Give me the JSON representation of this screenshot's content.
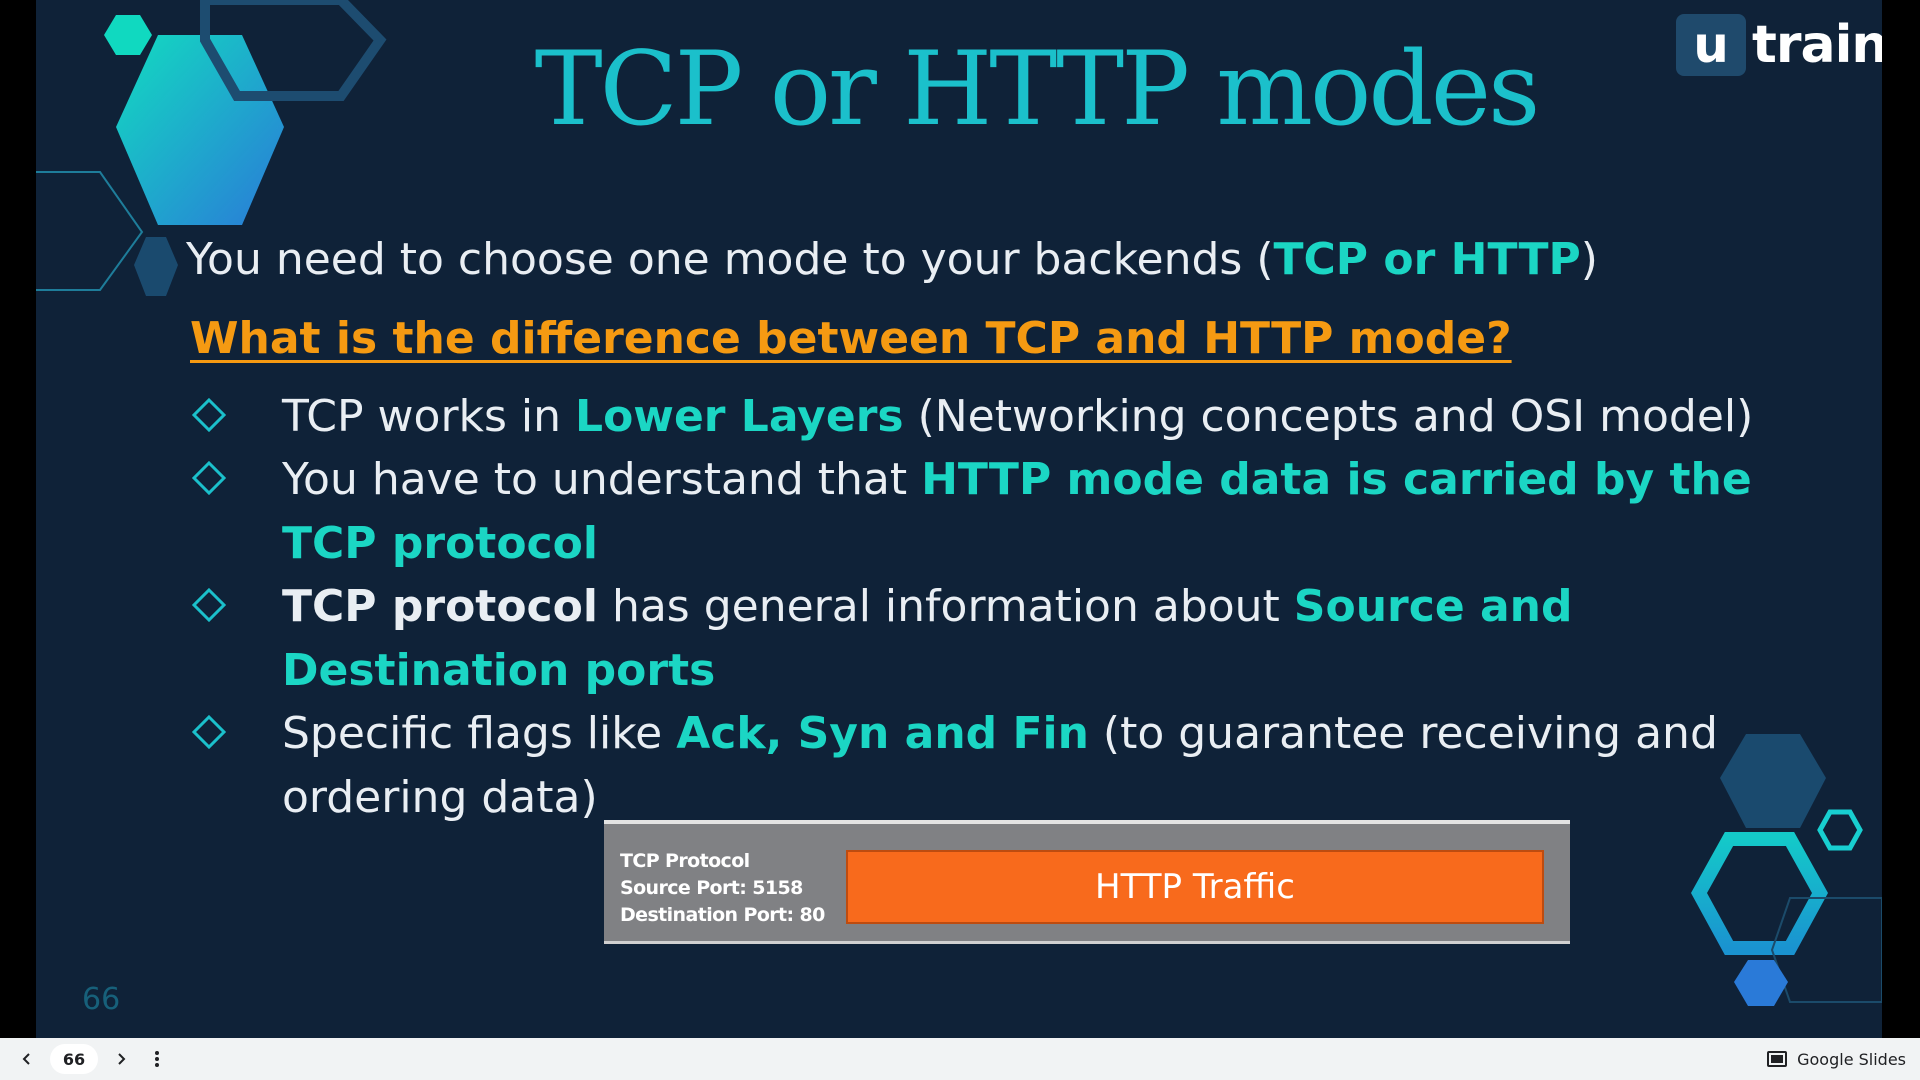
{
  "slide": {
    "title": "TCP or HTTP modes",
    "logo": {
      "mark": "u",
      "word": "train"
    },
    "intro": {
      "before": "You need to choose one mode to your backends (",
      "highlight": "TCP or HTTP",
      "after": ")"
    },
    "question": "What is the difference between TCP and HTTP mode?",
    "bullets": [
      {
        "icon": "diamond-bullet-icon",
        "lines": [
          {
            "a": "TCP works in ",
            "b": "Lower Layers",
            "c": " (Networking concepts and OSI model)"
          }
        ]
      },
      {
        "icon": "diamond-bullet-icon",
        "lines": [
          {
            "a": "You have to understand that ",
            "b": "HTTP mode data is carried by the"
          },
          {
            "b": "TCP protocol"
          }
        ]
      },
      {
        "icon": "diamond-bullet-icon",
        "lines": [
          {
            "w": "TCP protocol",
            "a": " has general information about ",
            "b": "Source and"
          },
          {
            "b": "Destination ports"
          }
        ]
      },
      {
        "icon": "diamond-bullet-icon",
        "lines": [
          {
            "a": "Specific flags like ",
            "b": "Ack, Syn and Fin",
            "c": " (to guarantee receiving and"
          },
          {
            "a": "ordering data)"
          }
        ]
      }
    ],
    "diagram": {
      "tcp_lines": [
        "TCP Protocol",
        "Source Port: 5158",
        "Destination Port: 80"
      ],
      "payload": "HTTP Traffic"
    },
    "page_number": "66",
    "colors": {
      "background": "#0f2238",
      "title": "#1bc0cb",
      "highlight": "#1bd6c4",
      "question": "#f59a12",
      "payload": "#f86a1c"
    }
  },
  "toolbar": {
    "prev_icon": "chevron-left-icon",
    "current_page": "66",
    "next_icon": "chevron-right-icon",
    "menu_icon": "more-vert-icon",
    "brand_icon": "slides-icon",
    "brand": "Google Slides"
  }
}
